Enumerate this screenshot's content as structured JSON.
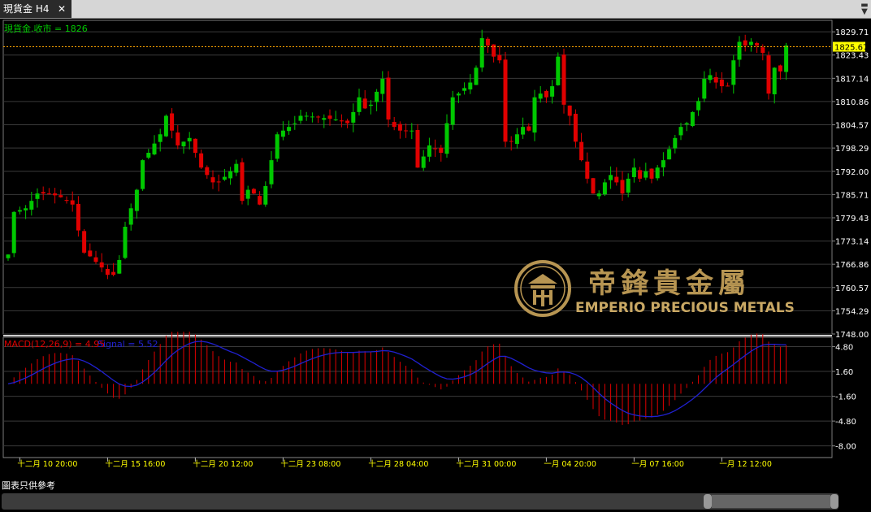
{
  "tab": {
    "title": "現貨金 H4",
    "close_glyph": "✕"
  },
  "price_pane": {
    "legend": "現貨金.收市 = 1826"
  },
  "macd_pane": {
    "legend_macd": "MACD(12,26,9) = 4.95",
    "legend_signal": "Signal = 5.52"
  },
  "current_price_label": "1825.67",
  "footer_note": "圖表只供參考",
  "watermark": {
    "cn": "帝鋒貴金屬",
    "en": "EMPERIO PRECIOUS METALS"
  },
  "colors": {
    "up": "#00c800",
    "down": "#e00000",
    "legend_green": "#00c800",
    "macd_hist": "#e00000",
    "signal": "#2020d0",
    "grid": "#3a3a3a",
    "axis_text": "#ffffff",
    "date_text": "#ffff00",
    "current_price_line": "#ffa500",
    "current_price_box": "#ffff00"
  },
  "chart_data": [
    {
      "type": "candlestick",
      "title": "現貨金 H4",
      "ylim": [
        1748.0,
        1831.5
      ],
      "yticks": [
        1829.71,
        1823.43,
        1817.14,
        1810.86,
        1804.57,
        1798.29,
        1792.0,
        1785.71,
        1779.43,
        1773.14,
        1766.86,
        1760.57,
        1754.29,
        1748.0
      ],
      "ytick_labels": [
        "1829.71",
        "1823.43",
        "1817.14",
        "1810.86",
        "1804.57",
        "1798.29",
        "1792.00",
        "1785.71",
        "1779.43",
        "1773.14",
        "1766.86",
        "1760.57",
        "1754.29",
        "1748.00"
      ],
      "xtick_labels": [
        "十二月 10 20:00",
        "十二月 15 16:00",
        "十二月 20 12:00",
        "十二月 23 08:00",
        "十二月 28 04:00",
        "十二月 31 00:00",
        "一月 04 20:00",
        "一月 07 16:00",
        "一月 12 12:00"
      ],
      "xtick_bar_index": [
        2,
        17,
        32,
        47,
        62,
        77,
        92,
        107,
        122
      ],
      "current_price": 1825.67,
      "ohlc_anchors": [
        {
          "i": 0,
          "c": 1769.5
        },
        {
          "i": 1,
          "c": 1781
        },
        {
          "i": 3,
          "c": 1782
        },
        {
          "i": 5,
          "c": 1786
        },
        {
          "i": 7,
          "c": 1786
        },
        {
          "i": 9,
          "c": 1785
        },
        {
          "i": 11,
          "c": 1783
        },
        {
          "i": 12,
          "c": 1776
        },
        {
          "i": 13,
          "c": 1770
        },
        {
          "i": 14,
          "c": 1769
        },
        {
          "i": 16,
          "c": 1766
        },
        {
          "i": 17,
          "c": 1764
        },
        {
          "i": 18,
          "c": 1764
        },
        {
          "i": 19,
          "c": 1768
        },
        {
          "i": 20,
          "c": 1777
        },
        {
          "i": 21,
          "c": 1782
        },
        {
          "i": 22,
          "c": 1787
        },
        {
          "i": 23,
          "c": 1795
        },
        {
          "i": 24,
          "c": 1797
        },
        {
          "i": 26,
          "c": 1802
        },
        {
          "i": 27,
          "c": 1807
        },
        {
          "i": 28,
          "c": 1803
        },
        {
          "i": 29,
          "c": 1799
        },
        {
          "i": 31,
          "c": 1801
        },
        {
          "i": 33,
          "c": 1793
        },
        {
          "i": 35,
          "c": 1789
        },
        {
          "i": 36,
          "c": 1789
        },
        {
          "i": 38,
          "c": 1792
        },
        {
          "i": 39,
          "c": 1794
        },
        {
          "i": 40,
          "c": 1784
        },
        {
          "i": 41,
          "c": 1787
        },
        {
          "i": 42,
          "c": 1786
        },
        {
          "i": 43,
          "c": 1783
        },
        {
          "i": 44,
          "c": 1788
        },
        {
          "i": 45,
          "c": 1795
        },
        {
          "i": 46,
          "c": 1802
        },
        {
          "i": 47,
          "c": 1803
        },
        {
          "i": 48,
          "c": 1804
        },
        {
          "i": 49,
          "c": 1805
        },
        {
          "i": 50,
          "c": 1807
        },
        {
          "i": 51,
          "c": 1807
        },
        {
          "i": 56,
          "c": 1806
        },
        {
          "i": 58,
          "c": 1805
        },
        {
          "i": 59,
          "c": 1808
        },
        {
          "i": 60,
          "c": 1812
        },
        {
          "i": 61,
          "c": 1809
        },
        {
          "i": 62,
          "c": 1810
        },
        {
          "i": 64,
          "c": 1817
        },
        {
          "i": 65,
          "c": 1806
        },
        {
          "i": 66,
          "c": 1804
        },
        {
          "i": 67,
          "c": 1803
        },
        {
          "i": 69,
          "c": 1803
        },
        {
          "i": 70,
          "c": 1793
        },
        {
          "i": 72,
          "c": 1799
        },
        {
          "i": 74,
          "c": 1797
        },
        {
          "i": 75,
          "c": 1805
        },
        {
          "i": 76,
          "c": 1812
        },
        {
          "i": 77,
          "c": 1813
        },
        {
          "i": 79,
          "c": 1816
        },
        {
          "i": 80,
          "c": 1820
        },
        {
          "i": 81,
          "c": 1828
        },
        {
          "i": 82,
          "c": 1826
        },
        {
          "i": 83,
          "c": 1823
        },
        {
          "i": 84,
          "c": 1822
        },
        {
          "i": 85,
          "c": 1800
        },
        {
          "i": 86,
          "c": 1800
        },
        {
          "i": 87,
          "c": 1802
        },
        {
          "i": 88,
          "c": 1804
        },
        {
          "i": 89,
          "c": 1803
        },
        {
          "i": 90,
          "c": 1812
        },
        {
          "i": 91,
          "c": 1813
        },
        {
          "i": 92,
          "c": 1812
        },
        {
          "i": 93,
          "c": 1815
        },
        {
          "i": 94,
          "c": 1823
        },
        {
          "i": 95,
          "c": 1810
        },
        {
          "i": 96,
          "c": 1807
        },
        {
          "i": 97,
          "c": 1800
        },
        {
          "i": 98,
          "c": 1795
        },
        {
          "i": 99,
          "c": 1790
        },
        {
          "i": 100,
          "c": 1786
        },
        {
          "i": 101,
          "c": 1786
        },
        {
          "i": 102,
          "c": 1789
        },
        {
          "i": 103,
          "c": 1791
        },
        {
          "i": 104,
          "c": 1789
        },
        {
          "i": 105,
          "c": 1786
        },
        {
          "i": 106,
          "c": 1790
        },
        {
          "i": 107,
          "c": 1793
        },
        {
          "i": 108,
          "c": 1790
        },
        {
          "i": 109,
          "c": 1792
        },
        {
          "i": 110,
          "c": 1790
        },
        {
          "i": 111,
          "c": 1793
        },
        {
          "i": 112,
          "c": 1795
        },
        {
          "i": 113,
          "c": 1798
        },
        {
          "i": 114,
          "c": 1801
        },
        {
          "i": 115,
          "c": 1804
        },
        {
          "i": 116,
          "c": 1805
        },
        {
          "i": 117,
          "c": 1808
        },
        {
          "i": 118,
          "c": 1811
        },
        {
          "i": 119,
          "c": 1817
        },
        {
          "i": 120,
          "c": 1818
        },
        {
          "i": 121,
          "c": 1816
        },
        {
          "i": 122,
          "c": 1815
        },
        {
          "i": 123,
          "c": 1815
        },
        {
          "i": 124,
          "c": 1822
        },
        {
          "i": 125,
          "c": 1827
        },
        {
          "i": 126,
          "c": 1826
        },
        {
          "i": 127,
          "c": 1827
        },
        {
          "i": 128,
          "c": 1826
        },
        {
          "i": 129,
          "c": 1824
        },
        {
          "i": 130,
          "c": 1813
        },
        {
          "i": 131,
          "c": 1820
        },
        {
          "i": 132,
          "c": 1819
        },
        {
          "i": 133,
          "c": 1826
        }
      ]
    },
    {
      "type": "macd",
      "title": "MACD(12,26,9)",
      "macd_value": 4.95,
      "signal_value": 5.52,
      "ylim": [
        -9.5,
        6.0
      ],
      "yticks": [
        4.8,
        1.6,
        -1.6,
        -4.8,
        -8.0
      ],
      "ytick_labels": [
        "4.80",
        "1.60",
        "-1.60",
        "-4.80",
        "-8.00"
      ]
    }
  ]
}
